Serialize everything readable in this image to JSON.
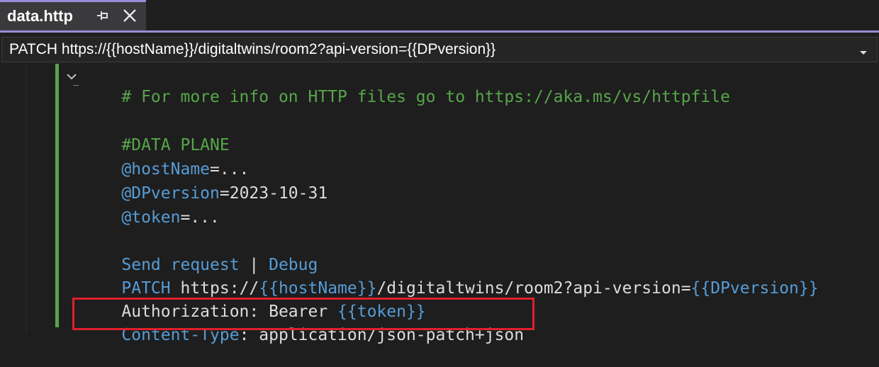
{
  "tab": {
    "title": "data.http",
    "pin_icon": "pin-icon",
    "close_icon": "close-icon"
  },
  "request_selector": {
    "value": "PATCH https://{{hostName}}/digitaltwins/room2?api-version={{DPversion}}",
    "chevron_icon": "chevron-down-icon"
  },
  "editor": {
    "lines": {
      "comment": "# For more info on HTTP files go to https://aka.ms/vs/httpfile",
      "section": "#DATA PLANE",
      "host_var": "@hostName",
      "host_val": "=...",
      "dp_var": "@DPversion",
      "dp_val": "=2023-10-31",
      "token_var": "@token",
      "token_val": "=...",
      "send_request": "Send request",
      "separator": " | ",
      "debug": "Debug",
      "method": "PATCH",
      "url_1": " https://",
      "url_host": "{{hostName}}",
      "url_2": "/digitaltwins/room2?api-version=",
      "url_dp": "{{DPversion}}",
      "auth_label": "Authorization: Bearer ",
      "auth_token": "{{token}}",
      "ct_label": "Content-Type",
      "ct_value": ": application/json-patch+json"
    }
  },
  "colors": {
    "accent_tab": "#9b8bd8",
    "comment": "#57a64a",
    "variable": "#569cd6",
    "plain_text": "#dcdcdc",
    "highlight_box": "#e0202c"
  }
}
